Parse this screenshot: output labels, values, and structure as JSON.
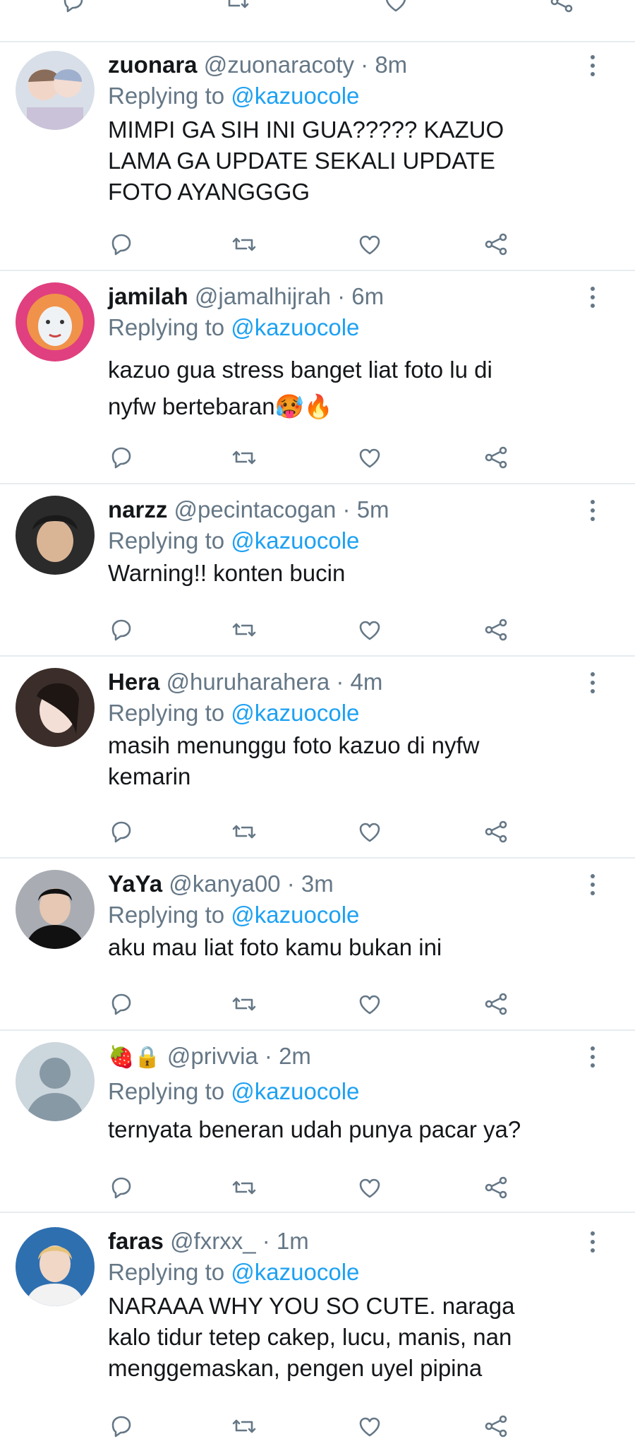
{
  "icons": {
    "reply": "reply-icon",
    "retweet": "retweet-icon",
    "like": "like-icon",
    "share": "share-icon",
    "more": "more-options-icon"
  },
  "colors": {
    "link": "#1da1f2",
    "secondary_text": "#657786",
    "primary_text": "#14171a",
    "divider": "#e6ecf0"
  },
  "tweets": [
    {
      "name": "zuonara",
      "handle": "@zuonaracoty",
      "time": "8m",
      "replying_prefix": "Replying to",
      "replying_to": "@kazuocole",
      "text": "MIMPI GA SIH INI GUA????? KAZUO\nLAMA GA UPDATE SEKALI UPDATE\nFOTO AYANGGGG"
    },
    {
      "name": "jamilah",
      "handle": "@jamalhijrah",
      "time": "6m",
      "replying_prefix": "Replying to",
      "replying_to": "@kazuocole",
      "text": "kazuo gua stress banget liat foto lu di\nnyfw bertebaran🥵🔥"
    },
    {
      "name": "narzz",
      "handle": "@pecintacogan",
      "time": "5m",
      "replying_prefix": "Replying to",
      "replying_to": "@kazuocole",
      "text": "Warning!! konten bucin"
    },
    {
      "name": "Hera",
      "handle": "@huruharahera",
      "time": "4m",
      "replying_prefix": "Replying to",
      "replying_to": "@kazuocole",
      "text": "masih menunggu foto kazuo di nyfw\nkemarin"
    },
    {
      "name": "YaYa",
      "handle": "@kanya00",
      "time": "3m",
      "replying_prefix": "Replying to",
      "replying_to": "@kazuocole",
      "text": "aku mau liat foto kamu bukan ini"
    },
    {
      "name": "🍓🔒",
      "handle": "@privvia",
      "time": "2m",
      "replying_prefix": "Replying to",
      "replying_to": "@kazuocole",
      "text": "ternyata beneran udah punya pacar ya?"
    },
    {
      "name": "faras",
      "handle": "@fxrxx_",
      "time": "1m",
      "replying_prefix": "Replying to",
      "replying_to": "@kazuocole",
      "text": "NARAAA WHY YOU SO CUTE. naraga\nkalo tidur tetep cakep, lucu, manis, nan\nmenggemaskan, pengen uyel pipina"
    }
  ]
}
